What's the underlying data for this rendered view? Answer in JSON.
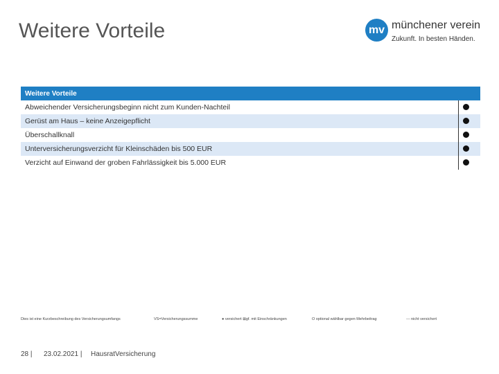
{
  "slide": {
    "title": "Weitere Vorteile"
  },
  "logo": {
    "mark": "mv",
    "name": "münchener verein",
    "tagline": "Zukunft. In besten Händen."
  },
  "table": {
    "header": "Weitere Vorteile",
    "rows": [
      {
        "label": "Abweichender Versicherungsbeginn nicht zum Kunden-Nachteil",
        "mark": "●"
      },
      {
        "label": "Gerüst am Haus – keine Anzeigepflicht",
        "mark": "●"
      },
      {
        "label": "Überschallknall",
        "mark": "●"
      },
      {
        "label": "Unterversicherungsverzicht für Kleinschäden bis 500 EUR",
        "mark": "●"
      },
      {
        "label": "Verzicht auf Einwand der groben Fahrlässigkeit bis 5.000 EUR",
        "mark": "●"
      }
    ]
  },
  "legend": {
    "item1": "Dies ist eine Kurzbeschreibung des Versicherungsumfangs",
    "item2": "VS=Versicherungssumme",
    "item3": "● versichert ⊠gf. mit Einschränkungen",
    "item4": "O optional wählbar gegen Mehrbeitrag",
    "item5": "--- nicht versichert"
  },
  "footer": {
    "page": "28 |",
    "date": "23.02.2021 |",
    "product": "HausratVersicherung"
  },
  "colors": {
    "accent": "#1f7fc4",
    "row_alt": "#dce8f6"
  }
}
